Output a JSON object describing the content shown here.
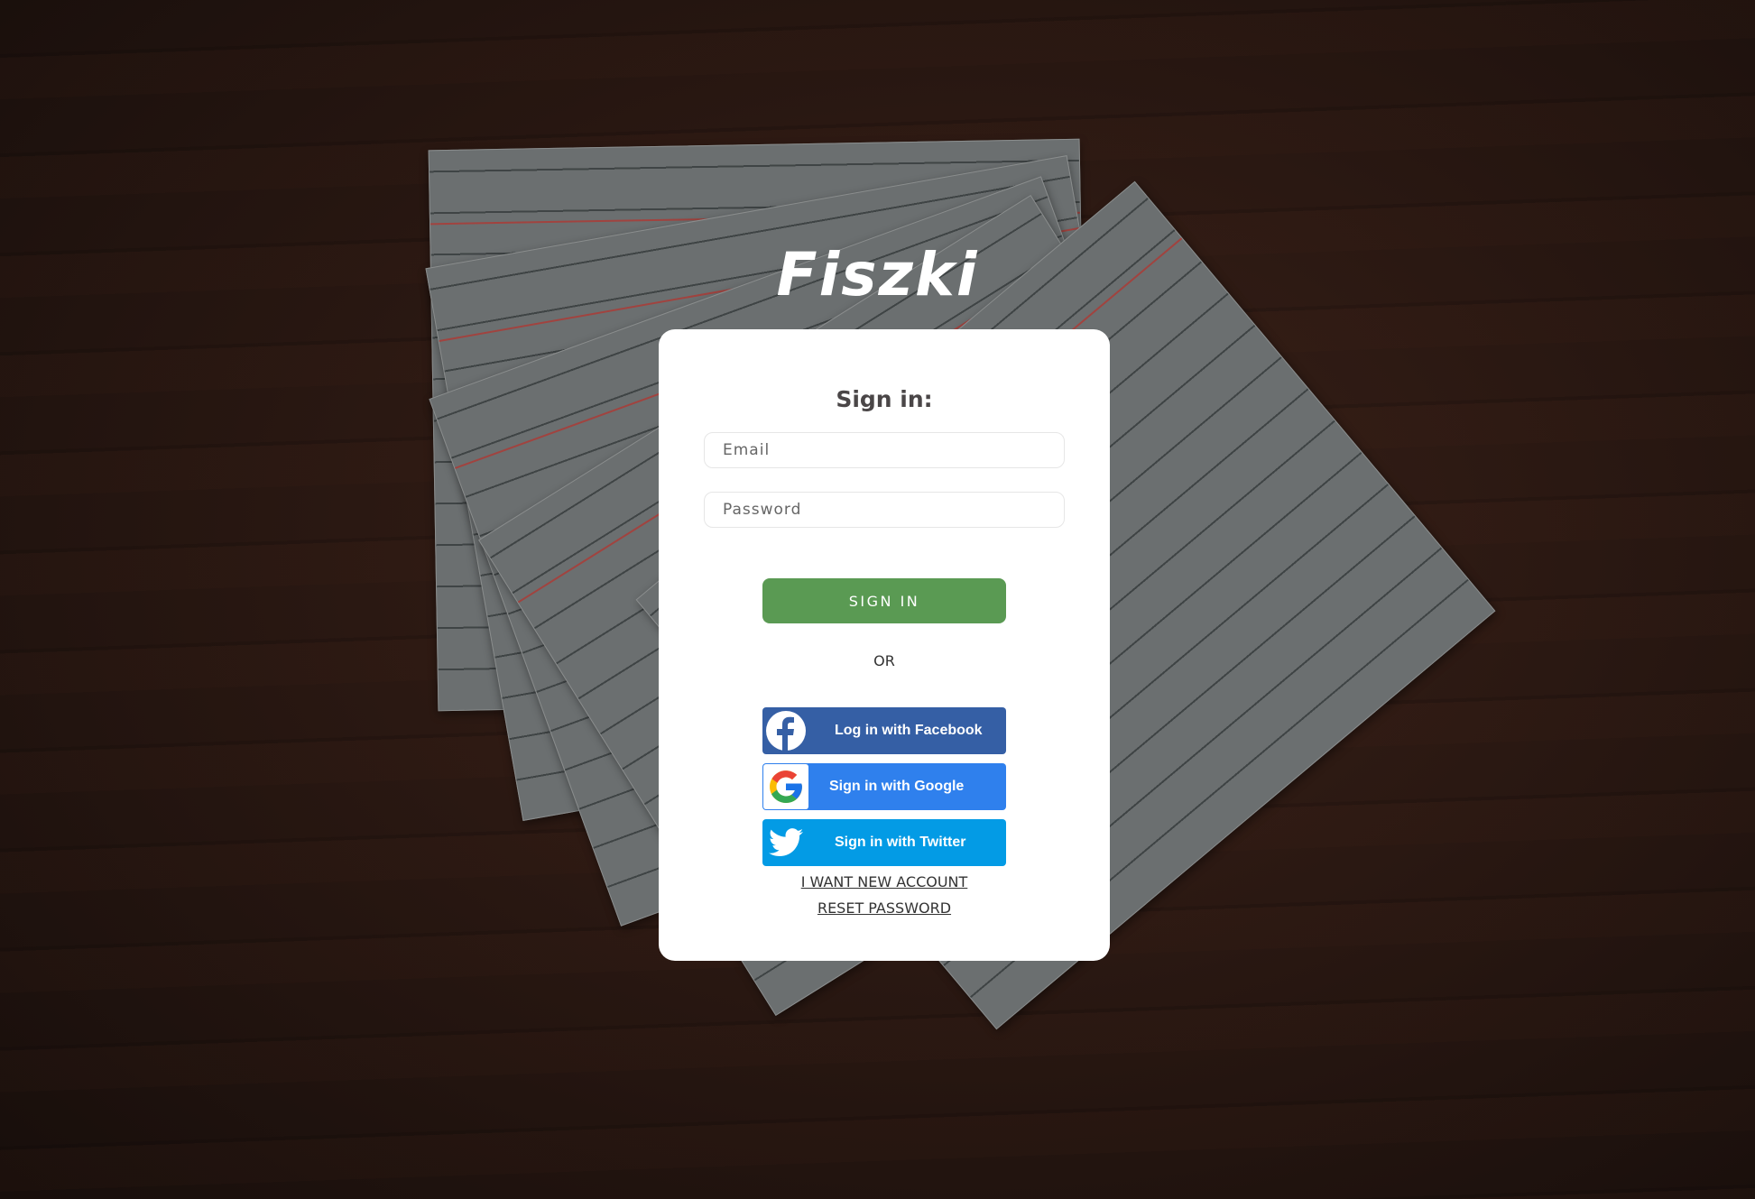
{
  "app": {
    "logo": "Fiszki"
  },
  "form": {
    "heading": "Sign in:",
    "email_placeholder": "Email",
    "password_placeholder": "Password",
    "sign_in_label": "SIGN IN",
    "or_label": "OR"
  },
  "social": {
    "facebook_label": "Log in with Facebook",
    "google_label": "Sign in with Google",
    "twitter_label": "Sign in with Twitter"
  },
  "links": {
    "new_account": "I WANT NEW ACCOUNT",
    "reset_password": "RESET PASSWORD"
  },
  "colors": {
    "sign_in": "#5a9a53",
    "facebook": "#355fa5",
    "google": "#2f80ed",
    "twitter": "#039be5"
  }
}
